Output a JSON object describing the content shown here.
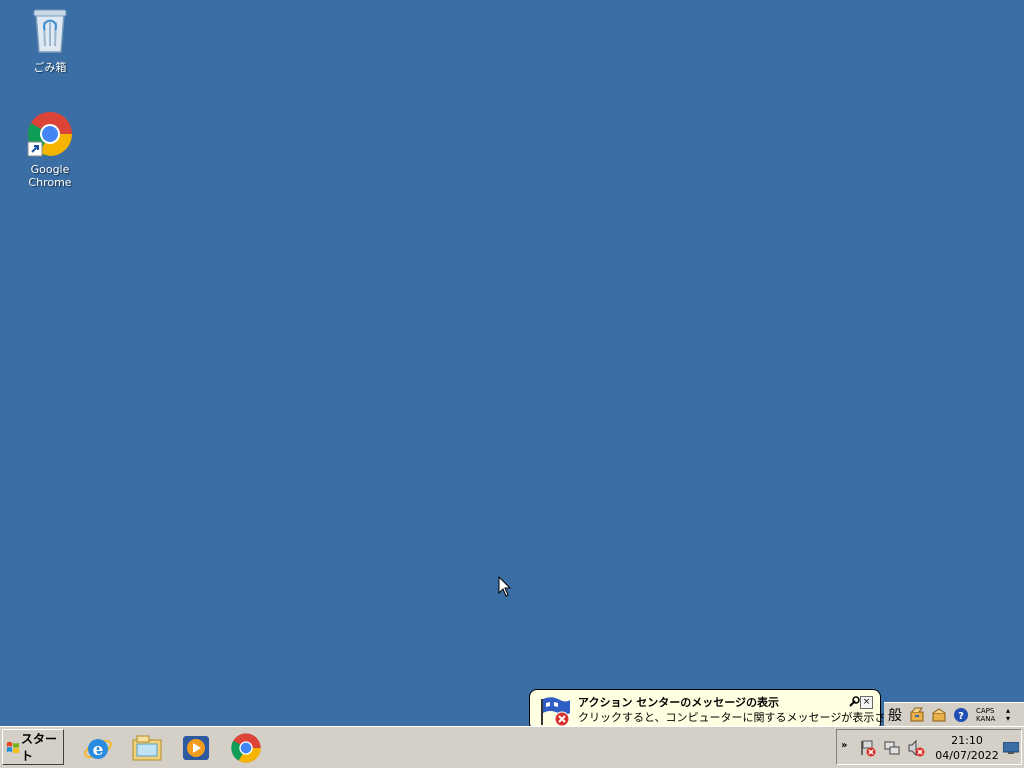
{
  "desktop": {
    "background": "#3a6ea5",
    "icons": [
      {
        "label": "ごみ箱",
        "icon": "recycle-bin-icon"
      },
      {
        "label": "Google Chrome",
        "icon": "chrome-icon"
      }
    ]
  },
  "balloon": {
    "title": "アクション センターのメッセージの表示",
    "text": "クリックすると、コンピューターに関するメッセージが表示されます。",
    "close_label": "×",
    "icon": "action-center-flag-icon"
  },
  "language_bar": {
    "mode_label": "般",
    "caps_label": "CAPS",
    "kana_label": "KANA",
    "help_label": "?"
  },
  "taskbar": {
    "start_label": "スタート",
    "pinned": [
      "internet-explorer-icon",
      "windows-explorer-icon",
      "windows-media-player-icon",
      "chrome-icon"
    ],
    "tray": {
      "expand_label": "»",
      "time": "21:10",
      "date": "04/07/2022"
    }
  }
}
